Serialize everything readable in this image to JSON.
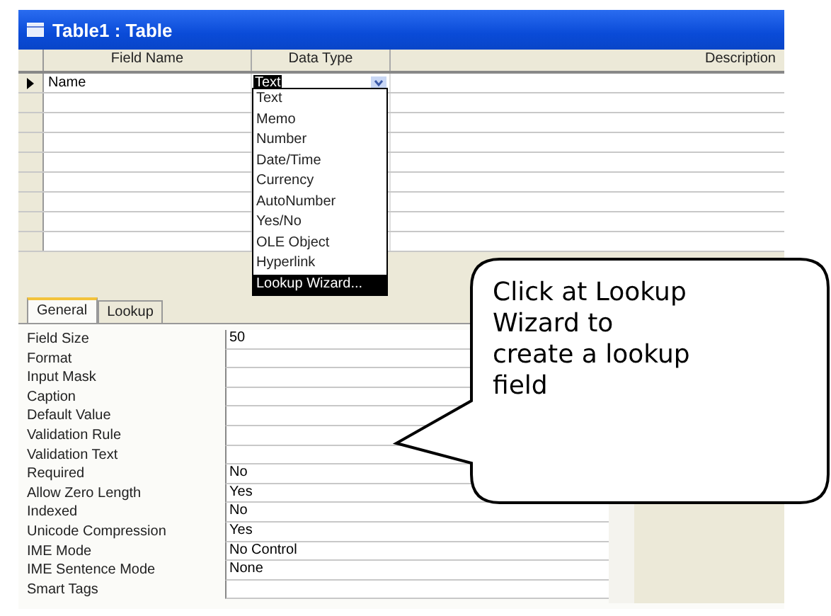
{
  "window": {
    "title": "Table1 : Table"
  },
  "table": {
    "columns": [
      "Field Name",
      "Data Type",
      "Description"
    ],
    "rows": [
      {
        "field_name": "Name",
        "data_type": "Text",
        "current": true
      }
    ]
  },
  "dropdown": {
    "items": [
      {
        "label": "Text",
        "selected": false
      },
      {
        "label": "Memo",
        "selected": false
      },
      {
        "label": "Number",
        "selected": false
      },
      {
        "label": "Date/Time",
        "selected": false
      },
      {
        "label": "Currency",
        "selected": false
      },
      {
        "label": "AutoNumber",
        "selected": false
      },
      {
        "label": "Yes/No",
        "selected": false
      },
      {
        "label": "OLE Object",
        "selected": false
      },
      {
        "label": "Hyperlink",
        "selected": false
      },
      {
        "label": "Lookup Wizard...",
        "selected": true
      }
    ]
  },
  "tabs": [
    {
      "label": "General",
      "selected": true
    },
    {
      "label": "Lookup",
      "selected": false
    }
  ],
  "properties": [
    {
      "label": "Field Size",
      "value": "50"
    },
    {
      "label": "Format"
    },
    {
      "label": "Input Mask"
    },
    {
      "label": "Caption"
    },
    {
      "label": "Default Value"
    },
    {
      "label": "Validation Rule"
    },
    {
      "label": "Validation Text"
    },
    {
      "label": "Required",
      "value": "No"
    },
    {
      "label": "Allow Zero Length",
      "value": "Yes"
    },
    {
      "label": "Indexed",
      "value": "No"
    },
    {
      "label": "Unicode Compression",
      "value": "Yes"
    },
    {
      "label": "IME Mode",
      "value": "No Control"
    },
    {
      "label": "IME Sentence Mode",
      "value": "None"
    },
    {
      "label": "Smart Tags"
    }
  ],
  "callout": {
    "text": "Click at Lookup Wizard to create a lookup field"
  }
}
